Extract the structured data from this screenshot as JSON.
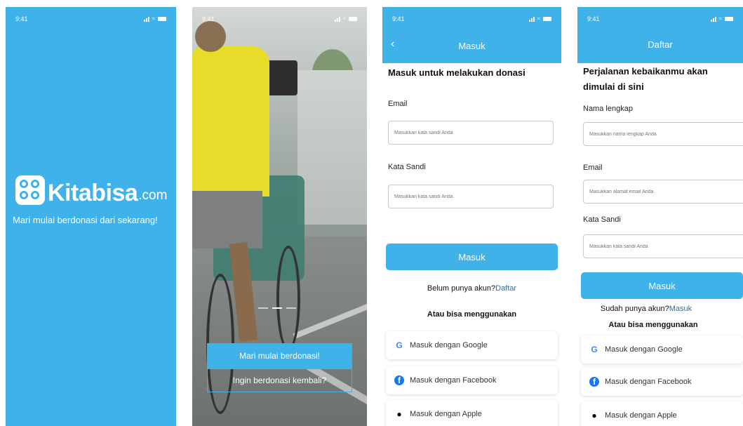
{
  "status_time": "9:41",
  "colors": {
    "brand": "#3fb3e9",
    "link": "#2a6fb2"
  },
  "splash": {
    "brand_name": "Kitabisa",
    "brand_suffix": ".com",
    "tagline": "Mari mulai berdonasi dari sekarang!"
  },
  "onboarding": {
    "primary_button": "Mari mulai berdonasi!",
    "secondary_button": "Ingin berdonasi kembali?"
  },
  "login": {
    "header_title": "Masuk",
    "heading": "Masuk untuk melakukan donasi",
    "email_label": "Email",
    "email_placeholder": "Masukkan kata sandi Anda",
    "password_label": "Kata Sandi",
    "password_placeholder": "Masukkan kata sandi Anda",
    "submit_label": "Masuk",
    "register_prompt": "Belum punya akun?",
    "register_link": "Daftar",
    "alt_text": "Atau bisa menggunakan",
    "social": [
      {
        "label": "Masuk dengan Google",
        "icon": "google-icon"
      },
      {
        "label": "Masuk dengan Facebook",
        "icon": "facebook-icon"
      },
      {
        "label": "Masuk dengan Apple",
        "icon": "apple-icon"
      }
    ]
  },
  "register": {
    "header_title": "Daftar",
    "heading_line1": "Perjalanan kebaikanmu akan",
    "heading_line2": "dimulai di sini",
    "name_label": "Nama lengkap",
    "name_placeholder": "Masukkan nama lengkap Anda",
    "email_label": "Email",
    "email_placeholder": "Masukkan alamat email Anda",
    "password_label": "Kata Sandi",
    "password_placeholder": "Masukkan kata sandi Anda",
    "submit_label": "Masuk",
    "login_prompt": "Sudah punya akun?",
    "login_link": "Masuk",
    "alt_text": "Atau bisa menggunakan",
    "social": [
      {
        "label": "Masuk dengan Google",
        "icon": "google-icon"
      },
      {
        "label": "Masuk dengan Facebook",
        "icon": "facebook-icon"
      },
      {
        "label": "Masuk dengan Apple",
        "icon": "apple-icon"
      }
    ]
  }
}
